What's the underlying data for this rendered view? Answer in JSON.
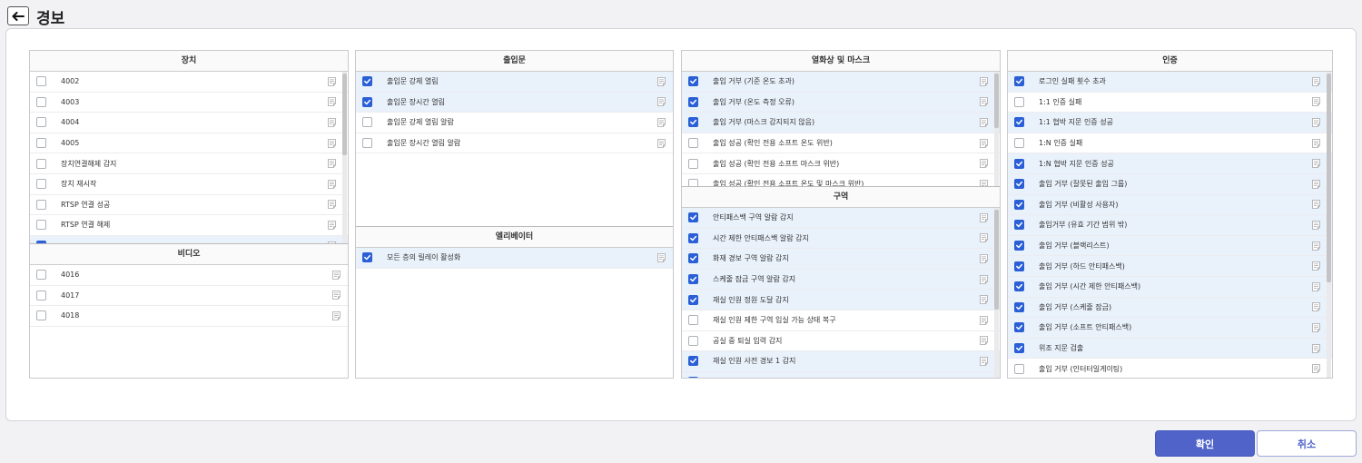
{
  "header": {
    "title": "경보"
  },
  "footer": {
    "confirm_label": "확인",
    "cancel_label": "취소"
  },
  "panels": {
    "device": {
      "title": "장치",
      "items": [
        {
          "label": "4002",
          "checked": false
        },
        {
          "label": "4003",
          "checked": false
        },
        {
          "label": "4004",
          "checked": false
        },
        {
          "label": "4005",
          "checked": false
        },
        {
          "label": "장치연결해제 감지",
          "checked": false
        },
        {
          "label": "장치 재시작",
          "checked": false
        },
        {
          "label": "RTSP 연결 성공",
          "checked": false
        },
        {
          "label": "RTSP 연결 해제",
          "checked": false
        },
        {
          "label": "",
          "checked": true
        }
      ]
    },
    "video": {
      "title": "비디오",
      "items": [
        {
          "label": "4016",
          "checked": false
        },
        {
          "label": "4017",
          "checked": false
        },
        {
          "label": "4018",
          "checked": false
        }
      ]
    },
    "door": {
      "title": "출입문",
      "items": [
        {
          "label": "출입문 강제 열림",
          "checked": true
        },
        {
          "label": "출입문 장시간 열림",
          "checked": true
        },
        {
          "label": "출입문 강제 열림 알람",
          "checked": false
        },
        {
          "label": "출입문 장시간 열림 알람",
          "checked": false
        }
      ]
    },
    "elevator": {
      "title": "엘리베이터",
      "items": [
        {
          "label": "모든 층의 릴레이 활성화",
          "checked": true
        }
      ]
    },
    "thermal": {
      "title": "열화상 및 마스크",
      "items": [
        {
          "label": "출입 거부 (기준 온도 초과)",
          "checked": true
        },
        {
          "label": "출입 거부 (온도 측정 오류)",
          "checked": true
        },
        {
          "label": "출입 거부 (마스크 감지되지 않음)",
          "checked": true
        },
        {
          "label": "출입 성공 (확인 전용 소프트 온도 위반)",
          "checked": false
        },
        {
          "label": "출입 성공 (확인 전용 소프트 마스크 위반)",
          "checked": false
        },
        {
          "label": "출입 성공 (확인 전용 소프트 온도 및 마스크 위반)",
          "checked": false
        }
      ]
    },
    "zone": {
      "title": "구역",
      "items": [
        {
          "label": "안티패스백 구역 알람 감지",
          "checked": true
        },
        {
          "label": "시간 제한 안티패스백 알람 감지",
          "checked": true
        },
        {
          "label": "화재 경보 구역 알람 감지",
          "checked": true
        },
        {
          "label": "스케줄 잠금 구역 알람 감지",
          "checked": true
        },
        {
          "label": "재실 인원 정원 도달 감지",
          "checked": true
        },
        {
          "label": "재실 인원 제한 구역 입실 가능 상태 복구",
          "checked": false
        },
        {
          "label": "공실 중 퇴실 입력 감지",
          "checked": false
        },
        {
          "label": "재실 인원 사전 경보 1 감지",
          "checked": true
        },
        {
          "label": "",
          "checked": true
        }
      ]
    },
    "auth": {
      "title": "인증",
      "items": [
        {
          "label": "로그인 실패 횟수 초과",
          "checked": true
        },
        {
          "label": "1:1 인증 실패",
          "checked": false
        },
        {
          "label": "1:1 협박 지문 인증 성공",
          "checked": true
        },
        {
          "label": "1:N 인증 실패",
          "checked": false
        },
        {
          "label": "1:N 협박 지문 인증 성공",
          "checked": true
        },
        {
          "label": "출입 거부 (잘못된 출입 그룹)",
          "checked": true
        },
        {
          "label": "출입 거부 (비활성 사용자)",
          "checked": true
        },
        {
          "label": "출입거부 (유효 기간 범위 밖)",
          "checked": true
        },
        {
          "label": "출입 거부 (블랙리스트)",
          "checked": true
        },
        {
          "label": "출입 거부 (하드 안티패스백)",
          "checked": true
        },
        {
          "label": "출입 거부 (시간 제한 안티패스백)",
          "checked": true
        },
        {
          "label": "출입 거부 (스케줄 잠금)",
          "checked": true
        },
        {
          "label": "출입 거부 (소프트 안티패스백)",
          "checked": true
        },
        {
          "label": "위조 지문 검출",
          "checked": true
        },
        {
          "label": "출입 거부 (인터터일게이팅)",
          "checked": false
        }
      ]
    }
  },
  "icons": {
    "back": "arrow-left-icon",
    "memo": "memo-icon",
    "check": "checkmark-icon"
  },
  "colors": {
    "accent": "#4f63c9",
    "checkbox_checked": "#2a5fd6",
    "row_checked_bg": "#e9f1fb"
  }
}
